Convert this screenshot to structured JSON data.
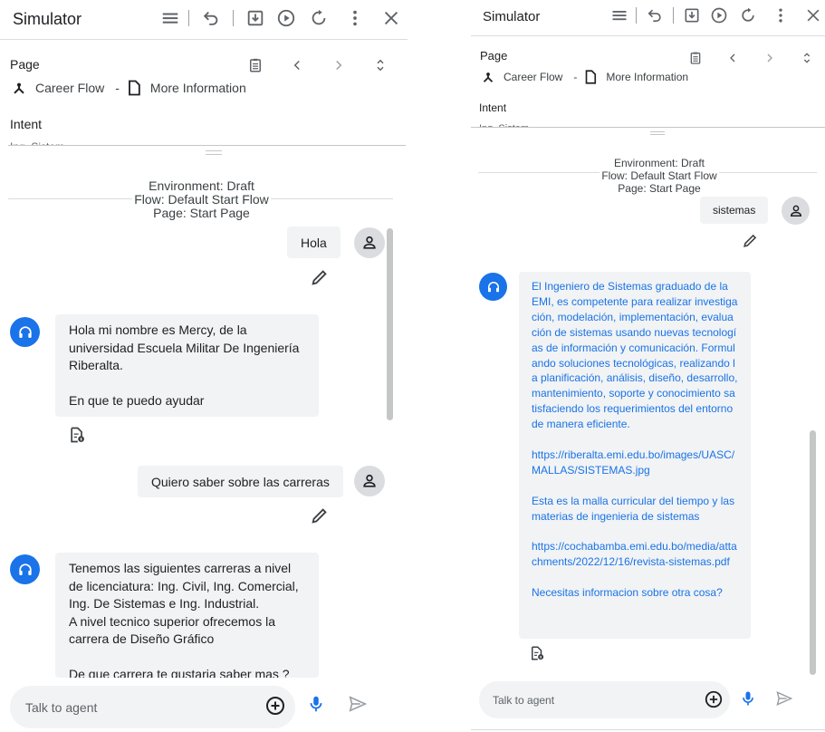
{
  "left": {
    "title": "Simulator",
    "page_label": "Page",
    "flow_name": "Career Flow",
    "crumb_sep": "-",
    "page_name": "More Information",
    "intent_label": "Intent",
    "intent_value": "Ing_Sistem",
    "env": {
      "environment": "Environment: Draft",
      "flow": "Flow: Default Start Flow",
      "page": "Page: Start Page"
    },
    "messages": {
      "user1": "Hola",
      "agent1": "Hola mi nombre es Mercy, de la universidad Escuela Militar De Ingeniería Riberalta.\n\nEn que te puedo ayudar",
      "user2": "Quiero saber sobre las carreras",
      "agent2": "Tenemos las siguientes carreras a nivel de licenciatura: Ing. Civil, Ing. Comercial, Ing. De Sistemas e Ing. Industrial.\nA nivel tecnico superior ofrecemos la carrera de Diseño Gráfico\n\nDe que carrera te gustaria saber mas ?"
    },
    "input_placeholder": "Talk to agent"
  },
  "right": {
    "title": "Simulator",
    "page_label": "Page",
    "flow_name": "Career Flow",
    "crumb_sep": "-",
    "page_name": "More Information",
    "intent_label": "Intent",
    "intent_value": "Ing_Sistem",
    "env": {
      "environment": "Environment: Draft",
      "flow": "Flow: Default Start Flow",
      "page": "Page: Start Page"
    },
    "messages": {
      "user1": "sistemas",
      "agent1": "El Ingeniero de Sistemas graduado de la EMI, es competente para realizar investigación, modelación, implementación, evaluación de sistemas usando nuevas tecnologías de información y comunicación. Formulando soluciones tecnológicas, realizando la planificación, análisis, diseño, desarrollo, mantenimiento, soporte y conocimiento satisfaciendo los requerimientos del entorno de manera eficiente.\n\nhttps://riberalta.emi.edu.bo/images/UASC/MALLAS/SISTEMAS.jpg\n\nEsta es la malla curricular del tiempo y las materias de ingenieria de sistemas\n\nhttps://cochabamba.emi.edu.bo/media/attachments/2022/12/16/revista-sistemas.pdf\n\nNecesitas informacion sobre otra cosa?"
    },
    "input_placeholder": "Talk to agent"
  },
  "colors": {
    "accent": "#1a73e8",
    "bubble": "#f1f3f4",
    "avatar_user": "#dadce0"
  },
  "icons": [
    "menu-icon",
    "undo-icon",
    "export-icon",
    "play-icon",
    "reset-icon",
    "more-vert-icon",
    "close-icon",
    "clipboard-icon",
    "chevron-left-icon",
    "chevron-right-icon",
    "unfold-icon",
    "flow-icon",
    "page-icon",
    "person-icon",
    "headset-icon",
    "edit-icon",
    "doc-info-icon",
    "add-circle-icon",
    "mic-icon",
    "send-icon"
  ]
}
